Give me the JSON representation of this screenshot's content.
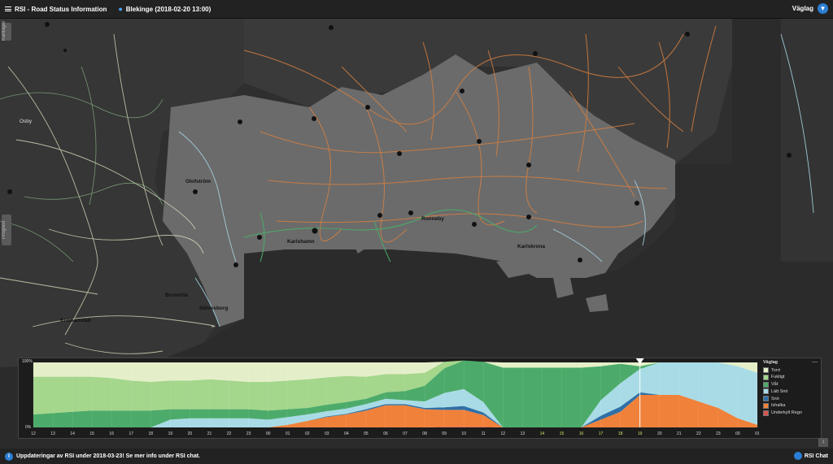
{
  "header": {
    "app_title": "RSI - Road Status Information",
    "location": "Blekinge (2018-02-20 13:00)",
    "layer_label": "Väglag",
    "layer_button_icon": "chevron-down-icon"
  },
  "map": {
    "side_tabs": [
      "Kartlager",
      "Prognos"
    ],
    "cities": [
      "Osby",
      "Olofström",
      "Karlshamn",
      "Ronneby",
      "Karlskrona",
      "Bromölla",
      "Sölvesborg",
      "Kristianstad"
    ]
  },
  "chart_data": {
    "type": "area",
    "stacked": true,
    "ylim": [
      0,
      100
    ],
    "y_ticks": [
      "100%",
      "0%"
    ],
    "x": [
      "12",
      "13",
      "14",
      "15",
      "16",
      "17",
      "18",
      "19",
      "20",
      "21",
      "22",
      "23",
      "00",
      "01",
      "02",
      "03",
      "04",
      "05",
      "06",
      "07",
      "08",
      "09",
      "10",
      "11",
      "12",
      "13",
      "14",
      "15",
      "16",
      "17",
      "18",
      "19",
      "20",
      "21",
      "22",
      "23",
      "00",
      "01"
    ],
    "current_marker": "19",
    "series": [
      {
        "name": "Underkylt Regn",
        "color": "#d9534f",
        "values": [
          0,
          0,
          0,
          0,
          0,
          0,
          0,
          0,
          0,
          0,
          0,
          0,
          0,
          0,
          0,
          0,
          0,
          0,
          0,
          0,
          0,
          1,
          1,
          1,
          0,
          0,
          0,
          0,
          0,
          0,
          0,
          0,
          0,
          0,
          0,
          0,
          0,
          0
        ]
      },
      {
        "name": "Ishalka",
        "color": "#f0813a",
        "values": [
          0,
          0,
          0,
          0,
          0,
          0,
          0,
          0,
          0,
          0,
          0,
          0,
          0,
          4,
          10,
          16,
          20,
          26,
          34,
          34,
          28,
          26,
          26,
          18,
          0,
          0,
          0,
          0,
          0,
          12,
          24,
          50,
          50,
          50,
          40,
          30,
          14,
          4
        ]
      },
      {
        "name": "Snö",
        "color": "#2e6fa7",
        "values": [
          0,
          0,
          0,
          0,
          0,
          0,
          0,
          0,
          0,
          0,
          0,
          0,
          0,
          0,
          0,
          1,
          1,
          2,
          2,
          2,
          2,
          4,
          6,
          4,
          0,
          0,
          0,
          0,
          0,
          6,
          8,
          4,
          0,
          0,
          0,
          0,
          0,
          0
        ]
      },
      {
        "name": "Lätt Snö",
        "color": "#a8dbe6",
        "values": [
          0,
          0,
          0,
          0,
          0,
          0,
          0,
          12,
          14,
          14,
          14,
          14,
          12,
          12,
          10,
          8,
          8,
          8,
          8,
          6,
          10,
          22,
          26,
          16,
          0,
          0,
          0,
          0,
          0,
          24,
          36,
          36,
          50,
          50,
          60,
          70,
          80,
          80
        ]
      },
      {
        "name": "Våt",
        "color": "#4cab6a",
        "values": [
          20,
          22,
          24,
          26,
          26,
          26,
          26,
          16,
          14,
          14,
          14,
          14,
          14,
          12,
          10,
          10,
          10,
          8,
          10,
          14,
          24,
          38,
          44,
          62,
          92,
          92,
          92,
          92,
          92,
          52,
          30,
          4,
          0,
          0,
          0,
          0,
          0,
          0
        ]
      },
      {
        "name": "Fuktigt",
        "color": "#a4d68c",
        "values": [
          58,
          56,
          54,
          52,
          50,
          46,
          44,
          44,
          44,
          46,
          44,
          42,
          44,
          44,
          44,
          42,
          40,
          34,
          28,
          26,
          20,
          10,
          0,
          0,
          0,
          0,
          0,
          0,
          0,
          0,
          0,
          0,
          0,
          0,
          0,
          0,
          0,
          0
        ]
      },
      {
        "name": "Torrt",
        "color": "#e4efc9",
        "values": [
          22,
          22,
          22,
          22,
          24,
          28,
          30,
          28,
          28,
          26,
          28,
          30,
          30,
          28,
          26,
          23,
          21,
          22,
          18,
          18,
          16,
          0,
          0,
          0,
          8,
          8,
          8,
          8,
          8,
          6,
          2,
          6,
          0,
          0,
          0,
          0,
          6,
          16
        ]
      }
    ]
  },
  "legend": {
    "title": "Väglag",
    "close": "—"
  },
  "footer": {
    "update_text": "Uppdateringar av RSI under 2018-03-23! Se mer info under RSI chat.",
    "chat_label": "RSI Chat"
  }
}
